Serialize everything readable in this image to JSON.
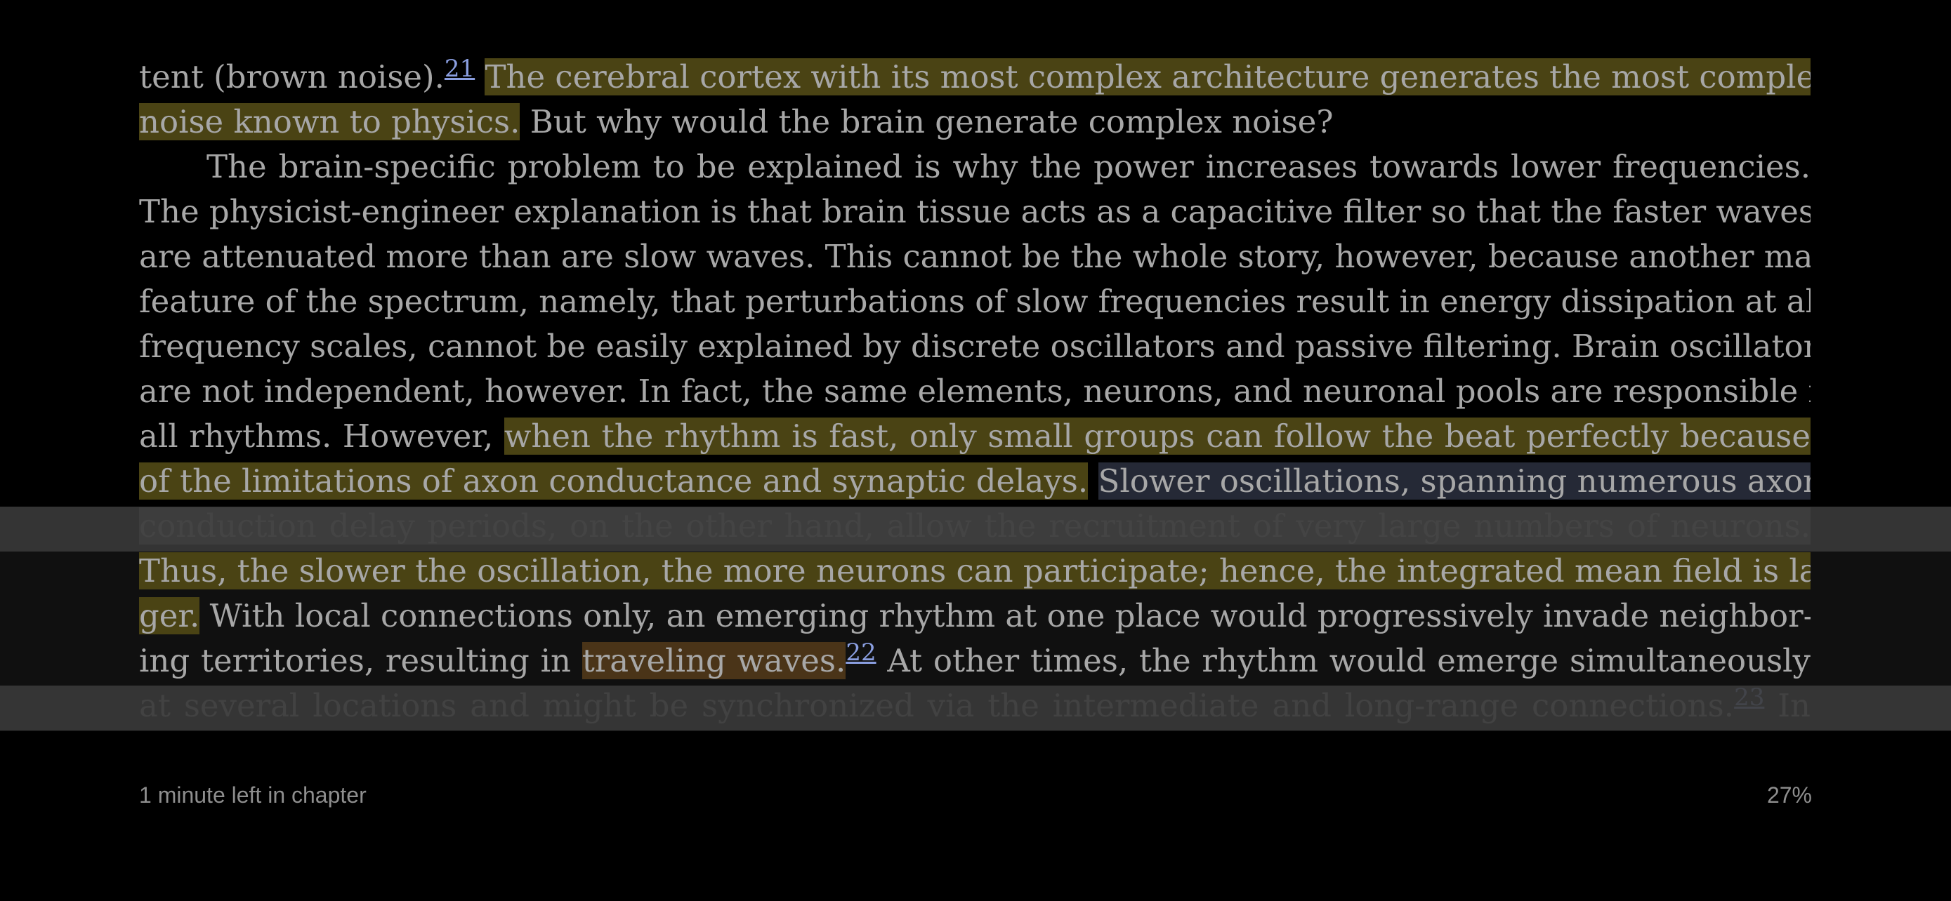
{
  "reader": {
    "lines": [
      {
        "segments": [
          {
            "text": "tent (brown noise).",
            "style": "plain"
          },
          {
            "text": "21",
            "style": "footnote"
          },
          {
            "text": " ",
            "style": "plain"
          },
          {
            "text": "The cerebral cortex with its most complex architecture generates the most complex",
            "style": "yellow"
          }
        ]
      },
      {
        "segments": [
          {
            "text": "noise known to physics.",
            "style": "yellow"
          },
          {
            "text": " But why would the brain generate complex noise?",
            "style": "plain"
          }
        ],
        "last": true
      },
      {
        "indent": true,
        "segments": [
          {
            "text": "The brain-specific problem to be explained is why the power increases towards lower frequencies.",
            "style": "plain"
          }
        ]
      },
      {
        "segments": [
          {
            "text": "The physicist-engineer explanation is that brain tissue acts as a capacitive filter so that the faster waves",
            "style": "plain"
          }
        ]
      },
      {
        "segments": [
          {
            "text": "are attenuated more than are slow waves. This cannot be the whole story, however, because another main",
            "style": "plain"
          }
        ]
      },
      {
        "segments": [
          {
            "text": "feature of the spectrum, namely, that perturbations of slow frequencies result in energy dissipation at all",
            "style": "plain"
          }
        ]
      },
      {
        "segments": [
          {
            "text": "frequency scales, cannot be easily explained by discrete oscillators and passive filtering. Brain oscillators",
            "style": "plain"
          }
        ]
      },
      {
        "segments": [
          {
            "text": "are not independent, however. In fact, the same elements, neurons, and neuronal pools are responsible for",
            "style": "plain"
          }
        ]
      },
      {
        "segments": [
          {
            "text": "all rhythms. However, ",
            "style": "plain"
          },
          {
            "text": "when the rhythm is fast, only small groups can follow the beat perfectly because",
            "style": "yellow"
          }
        ]
      },
      {
        "segments": [
          {
            "text": "of the limitations of axon conductance and synaptic delays.",
            "style": "yellow"
          },
          {
            "text": " ",
            "style": "plain"
          },
          {
            "text": "Slower oscillations, spanning numerous axon",
            "style": "blue"
          }
        ]
      },
      {
        "segments": [
          {
            "text": "conduction delay periods, on the other hand, allow the recruitment of very large numbers of neurons.",
            "style": "light"
          }
        ]
      },
      {
        "segments": [
          {
            "text": "Thus, the slower the oscillation, the more neurons can participate; hence, the integrated mean field is lar-",
            "style": "yellow"
          }
        ]
      },
      {
        "segments": [
          {
            "text": "ger.",
            "style": "yellow"
          },
          {
            "text": " With local connections only, an emerging rhythm at one place would progressively invade neighbor-",
            "style": "plain"
          }
        ]
      },
      {
        "segments": [
          {
            "text": "ing territories, resulting in ",
            "style": "plain"
          },
          {
            "text": "traveling waves.",
            "style": "orange"
          },
          {
            "text": "22",
            "style": "footnote"
          },
          {
            "text": " At other times, the rhythm would emerge simultaneously",
            "style": "plain"
          }
        ]
      },
      {
        "segments": [
          {
            "text": "at several locations and might be synchronized via the intermediate and long-range connections.",
            "style": "dim"
          },
          {
            "text": "23",
            "style": "footnote"
          },
          {
            "text": " In",
            "style": "dim"
          }
        ]
      }
    ]
  },
  "footer": {
    "time_left": "1 minute left in chapter",
    "progress": "27%"
  },
  "colors": {
    "highlight_yellow": "#4a4314",
    "highlight_blue": "#252936",
    "highlight_orange": "#4a3418",
    "footnote": "#8a9ee0",
    "background": "#000000"
  }
}
